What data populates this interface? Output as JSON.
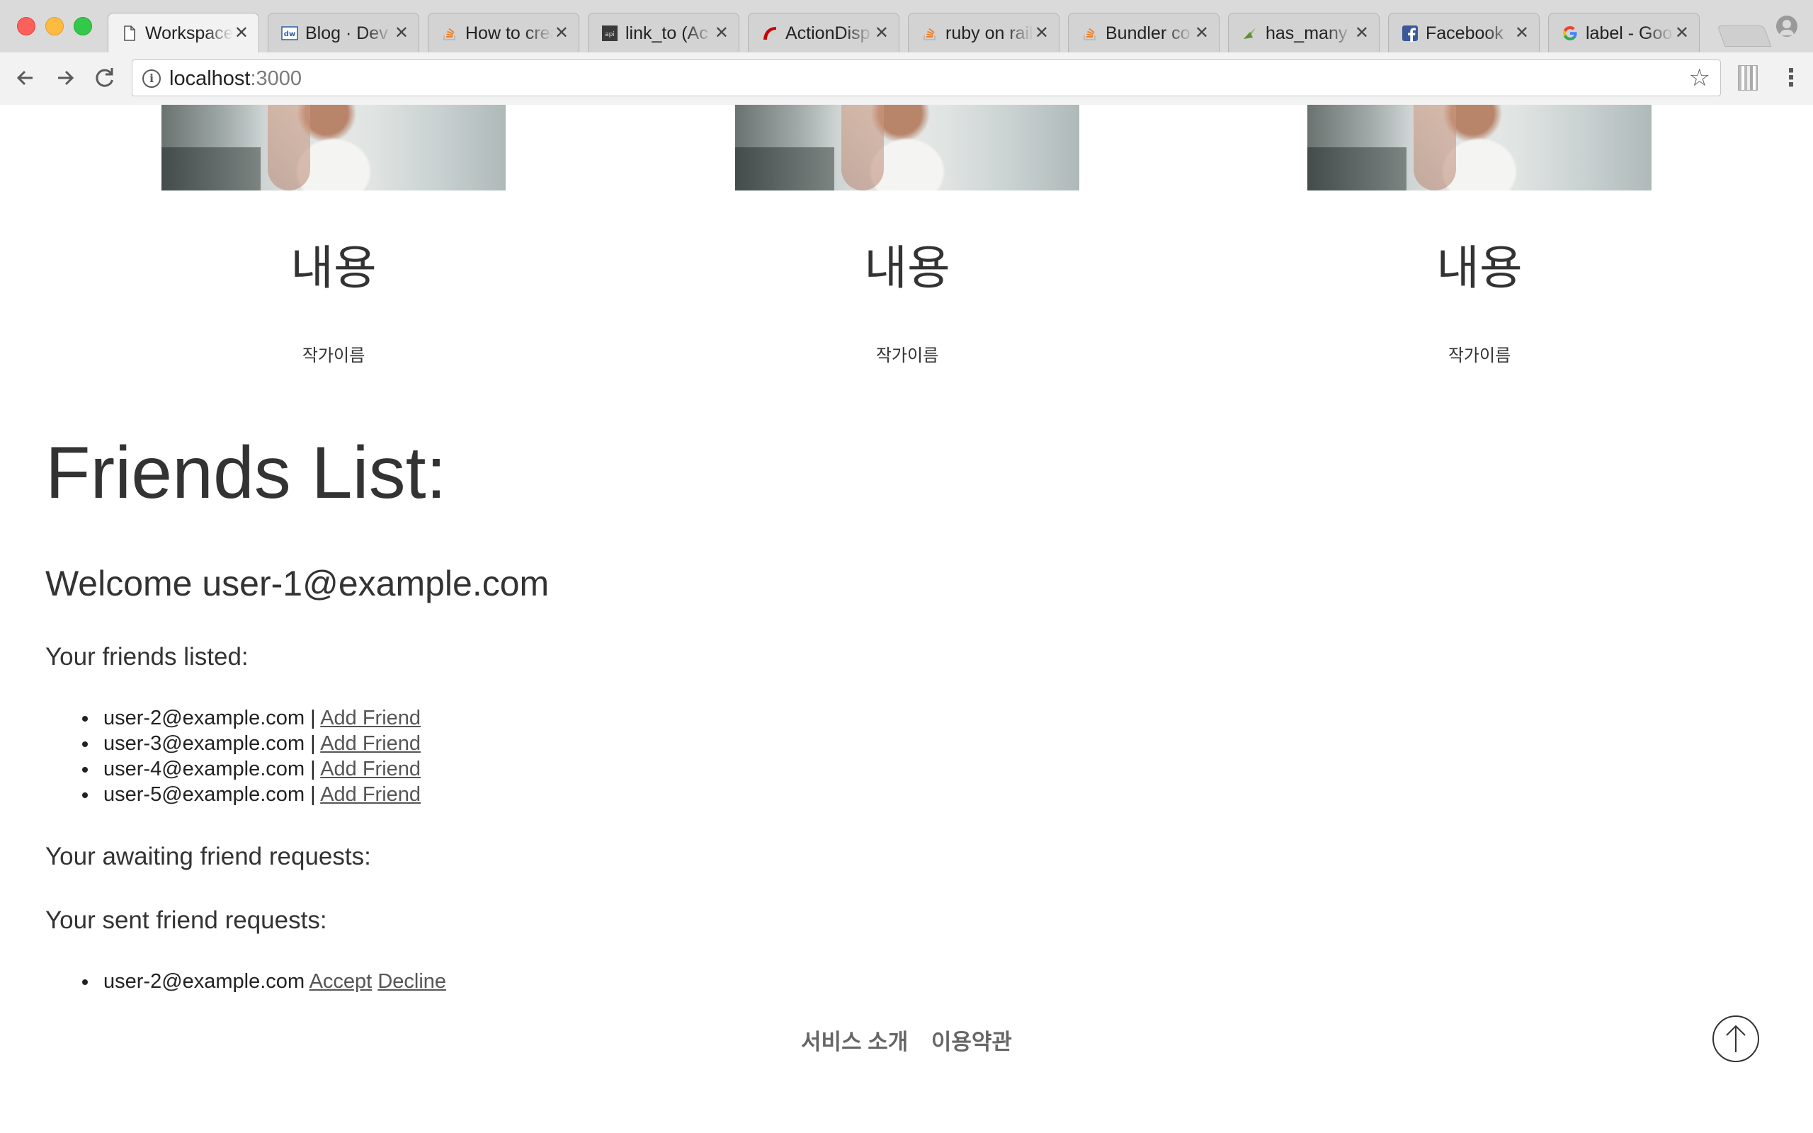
{
  "browser": {
    "tabs": [
      {
        "title": "Workspace",
        "icon": "document-icon",
        "active": true
      },
      {
        "title": "Blog · Dev",
        "icon": "dw-icon"
      },
      {
        "title": "How to create",
        "icon": "stackoverflow-icon"
      },
      {
        "title": "link_to (Ac",
        "icon": "apidock-icon"
      },
      {
        "title": "ActionDisp",
        "icon": "rails-icon"
      },
      {
        "title": "ruby on rails",
        "icon": "stackoverflow-icon"
      },
      {
        "title": "Bundler co",
        "icon": "stackoverflow-icon"
      },
      {
        "title": "has_many",
        "icon": "bird-icon"
      },
      {
        "title": "Facebook",
        "icon": "facebook-icon"
      },
      {
        "title": "label - Goo",
        "icon": "google-icon"
      }
    ],
    "url_host": "localhost",
    "url_port": ":3000"
  },
  "cards": [
    {
      "title": "내용",
      "author": "작가이름"
    },
    {
      "title": "내용",
      "author": "작가이름"
    },
    {
      "title": "내용",
      "author": "작가이름"
    }
  ],
  "friends": {
    "heading": "Friends List:",
    "welcome": "Welcome user-1@example.com",
    "listed_label": "Your friends listed:",
    "separator": "|",
    "listed": [
      {
        "email": "user-2@example.com",
        "action": "Add Friend"
      },
      {
        "email": "user-3@example.com",
        "action": "Add Friend"
      },
      {
        "email": "user-4@example.com",
        "action": "Add Friend"
      },
      {
        "email": "user-5@example.com",
        "action": "Add Friend"
      }
    ],
    "awaiting_label": "Your awaiting friend requests:",
    "sent_label": "Your sent friend requests:",
    "sent": [
      {
        "email": "user-2@example.com",
        "accept": "Accept",
        "decline": "Decline"
      }
    ]
  },
  "footer": {
    "service_intro": "서비스 소개",
    "terms": "이용약관"
  },
  "colors": {
    "facebook": "#3b5998",
    "stackoverflow": "#f48024",
    "rails": "#cc0000",
    "link": "#555555"
  }
}
